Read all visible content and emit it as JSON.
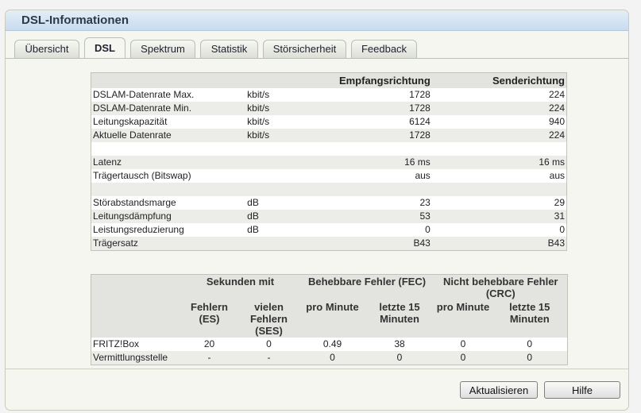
{
  "title": "DSL-Informationen",
  "tabs": [
    "Übersicht",
    "DSL",
    "Spektrum",
    "Statistik",
    "Störsicherheit",
    "Feedback"
  ],
  "active_tab": "DSL",
  "summary": {
    "col_down": "Empfangsrichtung",
    "col_up": "Senderichtung",
    "rows": [
      {
        "label": "DSLAM-Datenrate Max.",
        "unit": "kbit/s",
        "down": "1728",
        "up": "224"
      },
      {
        "label": "DSLAM-Datenrate Min.",
        "unit": "kbit/s",
        "down": "1728",
        "up": "224"
      },
      {
        "label": "Leitungskapazität",
        "unit": "kbit/s",
        "down": "6124",
        "up": "940"
      },
      {
        "label": "Aktuelle Datenrate",
        "unit": "kbit/s",
        "down": "1728",
        "up": "224"
      },
      {
        "label": "",
        "unit": "",
        "down": "",
        "up": ""
      },
      {
        "label": "Latenz",
        "unit": "",
        "down": "16 ms",
        "up": "16 ms"
      },
      {
        "label": "Trägertausch (Bitswap)",
        "unit": "",
        "down": "aus",
        "up": "aus"
      },
      {
        "label": "",
        "unit": "",
        "down": "",
        "up": ""
      },
      {
        "label": "Störabstandsmarge",
        "unit": "dB",
        "down": "23",
        "up": "29"
      },
      {
        "label": "Leitungsdämpfung",
        "unit": "dB",
        "down": "53",
        "up": "31"
      },
      {
        "label": "Leistungsreduzierung",
        "unit": "dB",
        "down": "0",
        "up": "0"
      },
      {
        "label": "Trägersatz",
        "unit": "",
        "down": "B43",
        "up": "B43"
      }
    ]
  },
  "errors": {
    "group_seconds": "Sekunden mit",
    "group_fec": "Behebbare Fehler (FEC)",
    "group_crc": "Nicht behebbare Fehler (CRC)",
    "col_es": "Fehlern (ES)",
    "col_ses": "vielen Fehlern (SES)",
    "col_fec_min": "pro Minute",
    "col_fec_15": "letzte 15 Minuten",
    "col_crc_min": "pro Minute",
    "col_crc_15": "letzte 15 Minuten",
    "rows": [
      {
        "label": "FRITZ!Box",
        "es": "20",
        "ses": "0",
        "fec_min": "0.49",
        "fec_15": "38",
        "crc_min": "0",
        "crc_15": "0"
      },
      {
        "label": "Vermittlungsstelle",
        "es": "-",
        "ses": "-",
        "fec_min": "0",
        "fec_15": "0",
        "crc_min": "0",
        "crc_15": "0"
      }
    ]
  },
  "buttons": {
    "refresh": "Aktualisieren",
    "help": "Hilfe"
  }
}
